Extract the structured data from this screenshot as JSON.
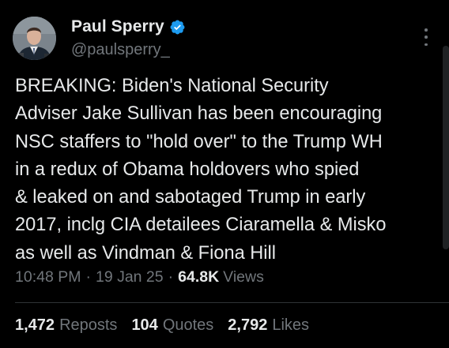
{
  "author": {
    "display_name": "Paul Sperry",
    "handle": "@paulsperry_",
    "verified": true,
    "verified_color": "#1d9bf0"
  },
  "tweet": {
    "text": "BREAKING: Biden's National Security\nAdviser Jake Sullivan has been encouraging\nNSC staffers to \"hold over\" to the Trump WH\nin a redux of Obama holdovers who spied\n& leaked on and sabotaged Trump in early\n2017, inclg CIA detailees Ciaramella & Misko\nas well as Vindman & Fiona Hill"
  },
  "meta": {
    "time": "10:48 PM",
    "separator": "·",
    "date": "19 Jan 25",
    "views_count": "64.8K",
    "views_label": "Views"
  },
  "stats": {
    "reposts_count": "1,472",
    "reposts_label": "Reposts",
    "quotes_count": "104",
    "quotes_label": "Quotes",
    "likes_count": "2,792",
    "likes_label": "Likes"
  },
  "icons": {
    "avatar": "avatar-photo",
    "verified": "verified-badge-icon",
    "more": "more-options-icon"
  },
  "colors": {
    "background": "#000000",
    "primary_text": "#e7e9ea",
    "secondary_text": "#71767b",
    "divider": "#2f3336"
  }
}
